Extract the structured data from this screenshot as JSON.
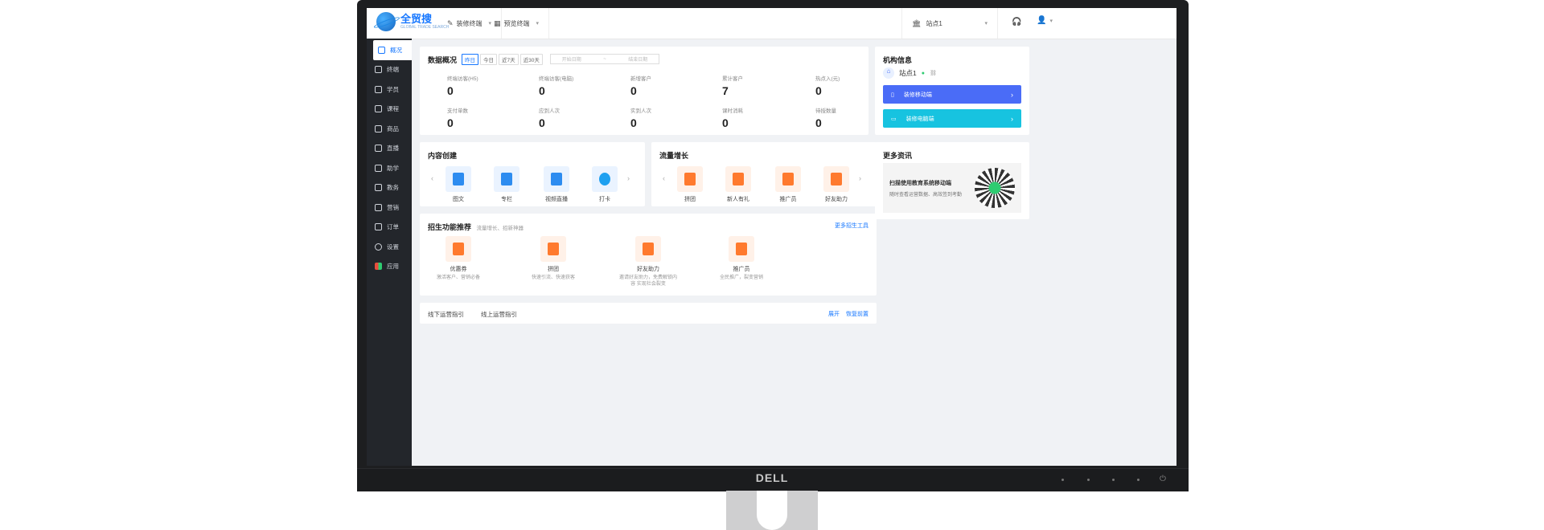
{
  "monitor": {
    "brand": "DELL"
  },
  "app": {
    "logo_text": "全贸搜",
    "logo_sub": "GLOBAL TRADE SEARCH"
  },
  "topnav": {
    "decorate_label": "装修终端",
    "preview_label": "预览终端",
    "site_label": "站点1"
  },
  "sidebar": {
    "items": [
      {
        "label": "概况",
        "active": true
      },
      {
        "label": "终端"
      },
      {
        "label": "学员"
      },
      {
        "label": "课程"
      },
      {
        "label": "商品"
      },
      {
        "label": "直播"
      },
      {
        "label": "助学"
      },
      {
        "label": "教务"
      },
      {
        "label": "营销"
      },
      {
        "label": "订单"
      },
      {
        "label": "设置"
      },
      {
        "label": "应用"
      }
    ]
  },
  "overview": {
    "title": "数据概况",
    "tabs": [
      "昨日",
      "今日",
      "近7天",
      "近30天"
    ],
    "active_tab": "昨日",
    "date_start_placeholder": "开始日期",
    "date_sep": "~",
    "date_end_placeholder": "结束日期",
    "stats": [
      {
        "label": "终端访客(H5)",
        "value": "0"
      },
      {
        "label": "终端访客(电脑)",
        "value": "0"
      },
      {
        "label": "新增客户",
        "value": "0"
      },
      {
        "label": "累计客户",
        "value": "7"
      },
      {
        "label": "热点入(元)",
        "value": "0"
      },
      {
        "label": "支付单数",
        "value": "0"
      },
      {
        "label": "应到人次",
        "value": "0"
      },
      {
        "label": "实到人次",
        "value": "0"
      },
      {
        "label": "课时消耗",
        "value": "0"
      },
      {
        "label": "待授数量",
        "value": "0"
      }
    ]
  },
  "content_create": {
    "title": "内容创建",
    "items": [
      "图文",
      "专栏",
      "视频直播",
      "打卡"
    ]
  },
  "traffic_growth": {
    "title": "流量增长",
    "items": [
      "拼团",
      "新人有礼",
      "推广员",
      "好友助力"
    ]
  },
  "recruit": {
    "title": "招生功能推荐",
    "subtitle": "流量增长、招新神器",
    "more_link": "更多招生工具",
    "items": [
      {
        "label": "优惠券",
        "desc": "激活客户、营销必备"
      },
      {
        "label": "拼团",
        "desc": "快速引流、快速获客"
      },
      {
        "label": "好友助力",
        "desc": "邀请好友助力，免费解锁内容 实现社会裂变"
      },
      {
        "label": "推广员",
        "desc": "全民推广，裂变营销"
      }
    ]
  },
  "guides": {
    "offline": "线下运营指引",
    "online": "线上运营指引",
    "expand": "展开",
    "restore": "恢复前置"
  },
  "org": {
    "title": "机构信息",
    "site_name": "站点1",
    "decorate_mobile": "装修移动端",
    "decorate_pc": "装修电脑端"
  },
  "more_info": {
    "title": "更多资讯",
    "qr_title": "扫描使用教育系统移动端",
    "qr_desc": "随时查看运营数据、高效签到考勤"
  },
  "colors": {
    "primary": "#1677ff",
    "button_blue": "#4a6cf7",
    "button_cyan": "#17c3e0",
    "sidebar": "#23262b"
  }
}
